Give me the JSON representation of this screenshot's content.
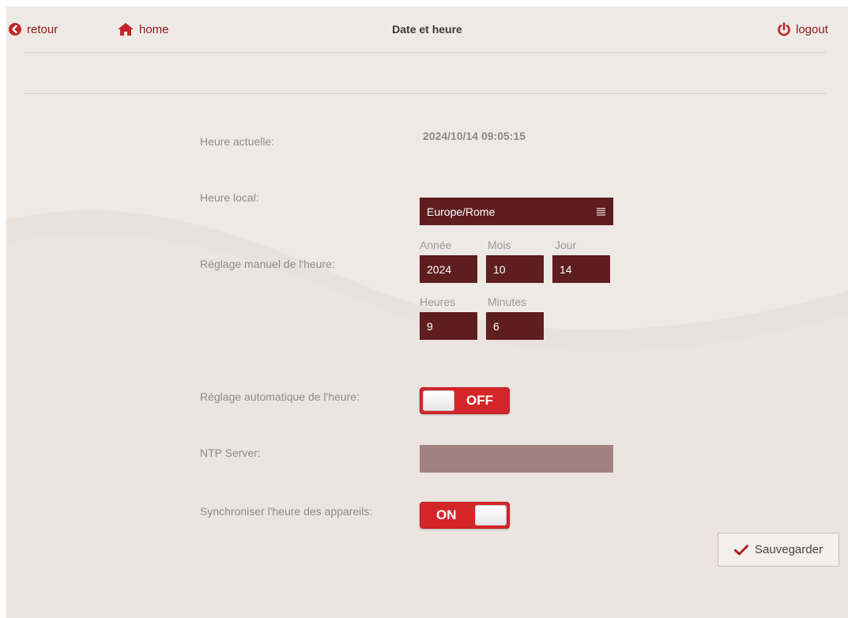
{
  "topbar": {
    "back_label": "retour",
    "home_label": "home",
    "title": "Date et heure",
    "logout_label": "logout"
  },
  "form": {
    "current_time_label": "Heure actuelle:",
    "current_time_value": "2024/10/14 09:05:15",
    "local_time_label": "Heure local:",
    "timezone_value": "Europe/Rome",
    "manual_label": "Réglage manuel de l'heure:",
    "year_label": "Année",
    "month_label": "Mois",
    "day_label": "Jour",
    "year_value": "2024",
    "month_value": "10",
    "day_value": "14",
    "hours_label": "Heures",
    "minutes_label": "Minutes",
    "hours_value": "9",
    "minutes_value": "6",
    "auto_label": "Réglage automatique de l'heure:",
    "auto_state": "OFF",
    "ntp_label": "NTP Server:",
    "ntp_value": "",
    "sync_label": "Synchroniser l'heure des appareils:",
    "sync_state": "ON"
  },
  "actions": {
    "save_label": "Sauvegarder"
  },
  "colors": {
    "accent": "#8b1a1a",
    "field_dark": "#5e1d1f",
    "toggle_red": "#d4262a",
    "ntp_disabled": "#a08381"
  },
  "icons": {
    "back": "chevron-left-circle-icon",
    "home": "home-icon",
    "logout": "power-icon",
    "select": "list-icon",
    "save": "checkmark-icon"
  }
}
